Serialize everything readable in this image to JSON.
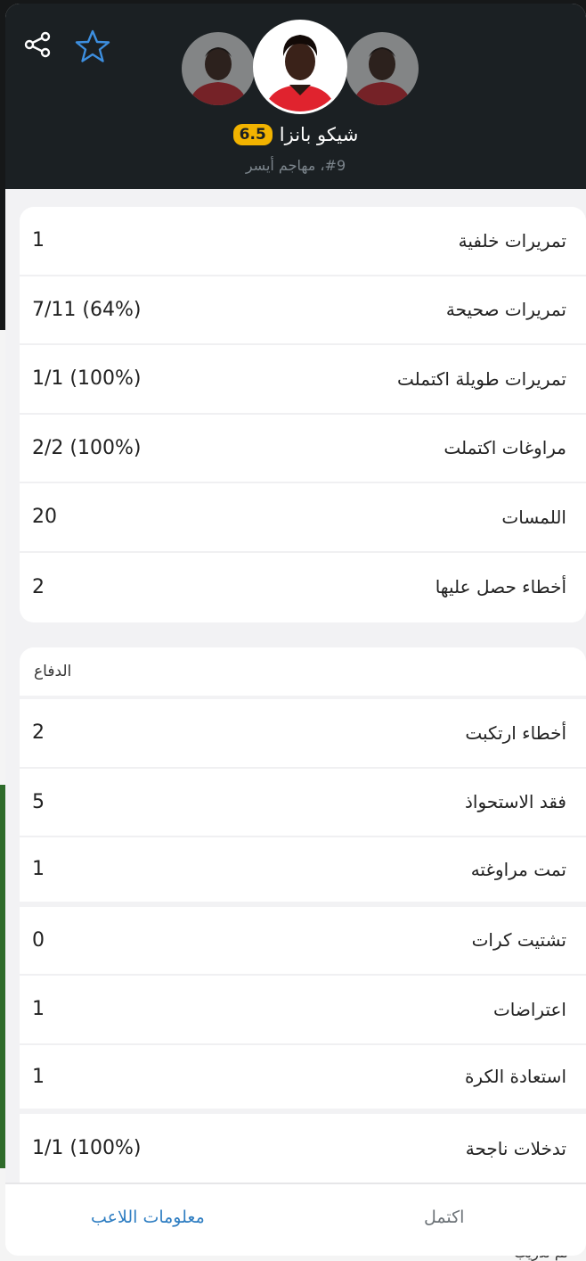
{
  "header": {
    "player_name": "شيكو بانزا",
    "rating": "6.5",
    "meta": "#9، مهاجم أيسر",
    "icons": {
      "share": "share-icon",
      "favorite": "star-icon"
    }
  },
  "stats_card": {
    "rows": [
      {
        "label": "تمريرات خلفية",
        "value": "1"
      },
      {
        "label": "تمريرات صحيحة",
        "value": "7/11 (64%)"
      },
      {
        "label": "تمريرات طويلة اكتملت",
        "value": "1/1 (100%)"
      },
      {
        "label": "مراوغات اكتملت",
        "value": "2/2 (100%)"
      },
      {
        "label": "اللمسات",
        "value": "20"
      },
      {
        "label": "أخطاء حصل عليها",
        "value": "2"
      }
    ]
  },
  "defense_card": {
    "title": "الدفاع",
    "rows": [
      {
        "label": "أخطاء ارتكبت",
        "value": "2"
      },
      {
        "label": "فقد الاستحواذ",
        "value": "5"
      },
      {
        "label": "تمت مراوغته",
        "value": "1"
      },
      {
        "label": "تشتيت كرات",
        "value": "0"
      },
      {
        "label": "اعتراضات",
        "value": "1"
      },
      {
        "label": "استعادة الكرة",
        "value": "1"
      },
      {
        "label": "تدخلات ناجحة",
        "value": "1/1 (100%)"
      }
    ]
  },
  "footer": {
    "player_info_label": "معلومات اللاعب",
    "complete_label": "اكتمل"
  },
  "background_text": "تم تدريب",
  "colors": {
    "accent": "#2f7ec2",
    "rating": "#f2b300",
    "header_bg": "#1b2023"
  }
}
